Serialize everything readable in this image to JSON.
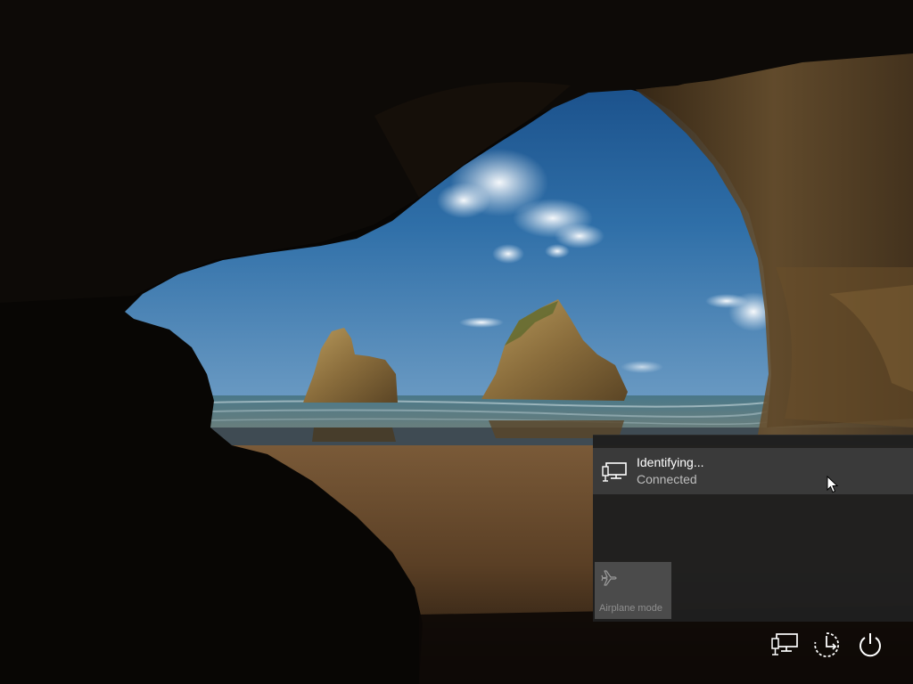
{
  "lock_screen": {
    "wallpaper": "beach-cave-wallpaper"
  },
  "network_flyout": {
    "network": {
      "icon": "wired-network-icon",
      "name": "Identifying...",
      "status": "Connected"
    },
    "quick_actions": [
      {
        "icon": "airplane-icon",
        "label": "Airplane mode",
        "state": "off"
      }
    ]
  },
  "system_buttons": [
    {
      "icon": "network-icon"
    },
    {
      "icon": "ease-of-access-icon"
    },
    {
      "icon": "power-icon"
    }
  ],
  "colors": {
    "flyout_bg": "#1f1f1f",
    "selected_item_bg": "#3a3a3a",
    "tile_bg": "#4b4b4b",
    "text_primary": "#ffffff",
    "text_secondary": "#bdbdbd"
  }
}
